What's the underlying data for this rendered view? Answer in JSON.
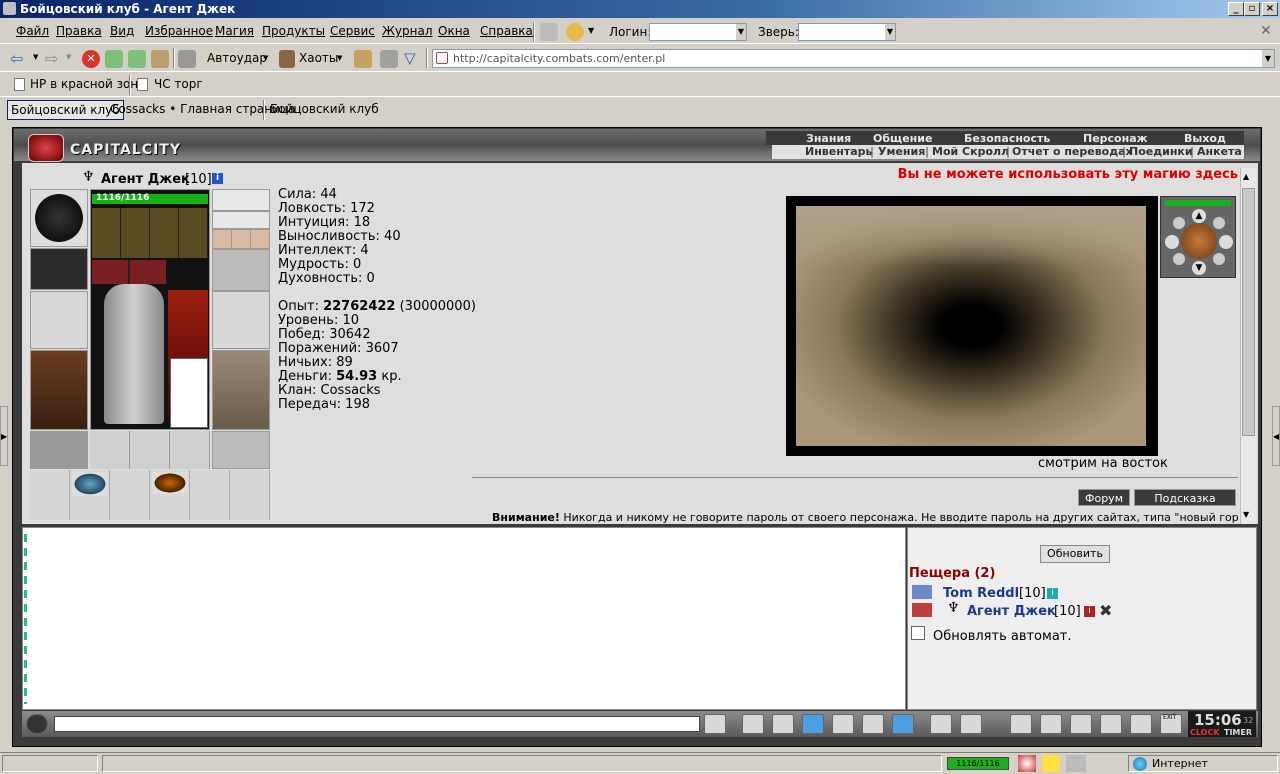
{
  "window": {
    "title": "Бойцовский клуб - Агент Джек"
  },
  "menu": [
    "Файл",
    "Правка",
    "Вид",
    "Избранное",
    "Магия",
    "Продукты",
    "Сервис",
    "Журнал",
    "Окна",
    "Справка"
  ],
  "login_label": "Логин:",
  "beast_label": "Зверь:",
  "toolbar": {
    "autoudar": "Автоудар",
    "haoty": "Хаоты"
  },
  "address": "http://capitalcity.combats.com/enter.pl",
  "links": [
    "HP в красной зоне",
    "ЧС торг"
  ],
  "tabs": [
    "Бойцовский клуб",
    "Cossacks • Главная страница",
    "Бойцовский клуб"
  ],
  "logo": "CAPITALCITY",
  "nav_top": [
    "Знания",
    "Общение",
    "Безопасность",
    "Персонаж",
    "Выход"
  ],
  "nav_bottom": [
    "Инвентарь",
    "Умения",
    "Мой Скролл",
    "Отчет о переводах",
    "Поединки",
    "Анкета"
  ],
  "char": {
    "name": "Агент Джек",
    "level": "[10]",
    "hp": "1116/1116",
    "hp_fraction": 1.0
  },
  "stats": [
    "Сила: 44",
    "Ловкость: 172",
    "Интуиция: 18",
    "Выносливость: 40",
    "Интеллект: 4",
    "Мудрость: 0",
    "Духовность: 0"
  ],
  "exp": {
    "label": "Опыт: ",
    "value": "22762422",
    "max": " (30000000)"
  },
  "stats2": [
    "Уровень: 10",
    "Побед: 30642",
    "Поражений: 3607",
    "Ничьих: 89"
  ],
  "money": {
    "label": "Деньги: ",
    "value": "54.93",
    "unit": " кр."
  },
  "stats3": [
    "Клан: Cossacks",
    "Передач: 198"
  ],
  "warning": "Вы не можете использовать эту магию здесь",
  "direction": "смотрим на восток",
  "btn_forum": "Форум",
  "btn_hint": "Подсказка",
  "notice_bold": "Внимание!",
  "notice": " Никогда и никому не говорите пароль от своего персонажа. Не вводите пароль на других сайтах, типа \"новый город\",",
  "refresh": "Обновить",
  "location": "Пещера (2)",
  "players": [
    {
      "name": "Tom Reddl",
      "level": "[10]"
    },
    {
      "name": "Агент Джек",
      "level": "[10]"
    }
  ],
  "auto_refresh": "Обновлять автомат.",
  "clock": {
    "time": "15:06",
    "sec": "32",
    "clock_label": "CLOCK",
    "timer_label": "TIMER",
    "exit": "EXIT"
  },
  "status": {
    "hp": "1116/1116",
    "zone": "Интернет"
  },
  "colors": {
    "warning": "#e00000",
    "player": "#1a3a8a",
    "location": "#8b0000",
    "hp": "#1bb11b"
  }
}
